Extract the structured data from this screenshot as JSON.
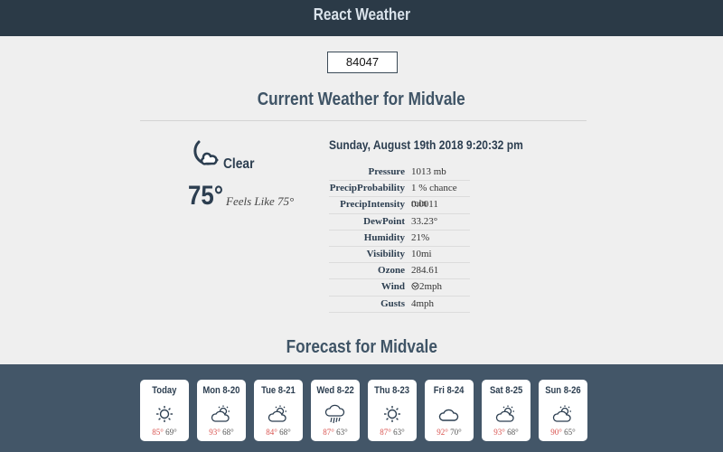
{
  "header": {
    "title": "React Weather"
  },
  "search": {
    "zip": "84047"
  },
  "current": {
    "title": "Current Weather for Midvale",
    "icon": "partly-cloudy-night-icon",
    "summary": "Clear",
    "temperature": "75°",
    "feels_like": "Feels Like 75°",
    "date": "Sunday, August 19th 2018 9:20:32 pm",
    "details": [
      {
        "label": "Pressure",
        "value": "1013 mb"
      },
      {
        "label": "PrecipProbability",
        "value": "1 % chance rain"
      },
      {
        "label": "PrecipIntensity",
        "value": "0.0011"
      },
      {
        "label": "DewPoint",
        "value": "33.23°"
      },
      {
        "label": "Humidity",
        "value": "21%"
      },
      {
        "label": "Visibility",
        "value": "10mi"
      },
      {
        "label": "Ozone",
        "value": "284.61"
      },
      {
        "label": "Wind",
        "value": "2mph",
        "icon": "wind-direction-icon"
      },
      {
        "label": "Gusts",
        "value": "4mph"
      }
    ]
  },
  "forecast": {
    "title": "Forecast for Midvale",
    "days": [
      {
        "day": "Today",
        "icon": "sun-icon",
        "high": "85°",
        "low": "69°"
      },
      {
        "day": "Mon 8-20",
        "icon": "partly-cloudy-icon",
        "high": "93°",
        "low": "68°"
      },
      {
        "day": "Tue 8-21",
        "icon": "partly-cloudy-icon",
        "high": "84°",
        "low": "68°"
      },
      {
        "day": "Wed 8-22",
        "icon": "rain-cloud-icon",
        "high": "87°",
        "low": "63°"
      },
      {
        "day": "Thu 8-23",
        "icon": "sun-icon",
        "high": "87°",
        "low": "63°"
      },
      {
        "day": "Fri 8-24",
        "icon": "cloud-icon",
        "high": "92°",
        "low": "70°"
      },
      {
        "day": "Sat 8-25",
        "icon": "partly-cloudy-icon",
        "high": "93°",
        "low": "68°"
      },
      {
        "day": "Sun 8-26",
        "icon": "partly-cloudy-icon",
        "high": "90°",
        "low": "65°"
      }
    ]
  },
  "colors": {
    "header": "#2b3a47",
    "forecast_band": "#435668",
    "high_temp": "#d9534f",
    "title": "#3f5466"
  }
}
